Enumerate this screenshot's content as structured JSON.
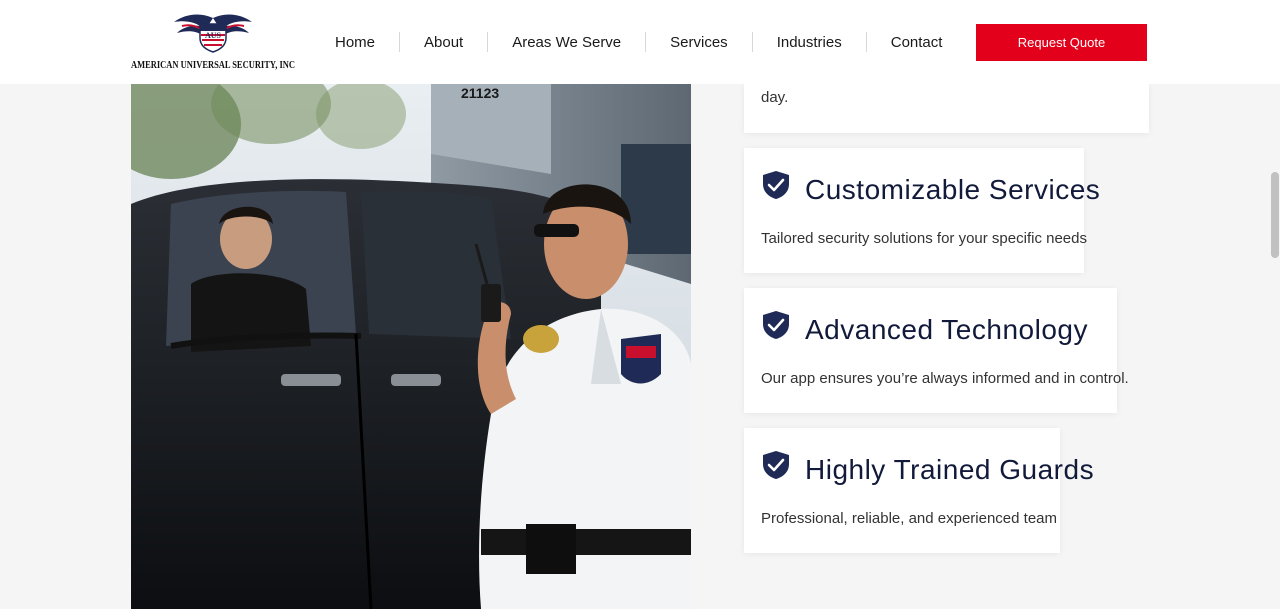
{
  "brand": {
    "logo_text": "AMERICAN UNIVERSAL SECURITY, INC",
    "logo_mark_text": "AUS"
  },
  "nav": {
    "items": [
      {
        "label": "Home"
      },
      {
        "label": "About"
      },
      {
        "label": "Areas We Serve"
      },
      {
        "label": "Services"
      },
      {
        "label": "Industries"
      },
      {
        "label": "Contact"
      }
    ],
    "cta_label": "Request Quote"
  },
  "photo": {
    "building_number": "21123"
  },
  "features": {
    "partial_text": "day.",
    "items": [
      {
        "title": "Customizable Services",
        "text": "Tailored security solutions for your specific needs"
      },
      {
        "title": "Advanced Technology",
        "text": "Our app ensures you’re always informed and in control."
      },
      {
        "title": "Highly Trained Guards",
        "text": "Professional, reliable, and experienced team"
      }
    ]
  },
  "colors": {
    "accent": "#e2001a",
    "heading": "#111a3a",
    "icon": "#1f2a56"
  },
  "icons": {
    "feature_icon": "shield-check-icon"
  }
}
